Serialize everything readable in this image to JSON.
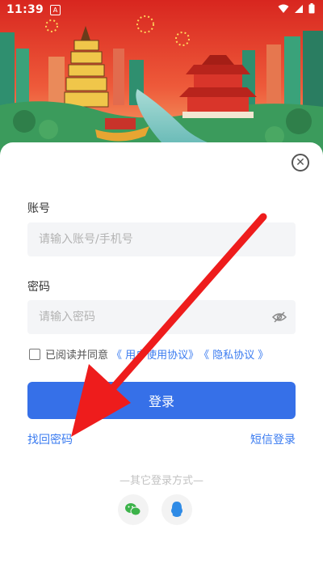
{
  "status_bar": {
    "time": "11:39",
    "notification_icon": "A"
  },
  "banner": {
    "description_icon": "city-landscape-illustration"
  },
  "form": {
    "account_label": "账号",
    "account_placeholder": "请输入账号/手机号",
    "password_label": "密码",
    "password_placeholder": "请输入密码",
    "agree_text": "已阅读并同意",
    "user_agreement": "《 用户使用协议》",
    "privacy_policy": "《 隐私协议 》",
    "login_button": "登录",
    "forgot_password": "找回密码",
    "sms_login": "短信登录"
  },
  "other_login": {
    "label": "—其它登录方式—",
    "methods": [
      "wechat-icon",
      "qq-icon"
    ]
  },
  "colors": {
    "primary": "#3670e8",
    "link": "#3a7bf0",
    "annotation_arrow": "#ee1c1c"
  }
}
